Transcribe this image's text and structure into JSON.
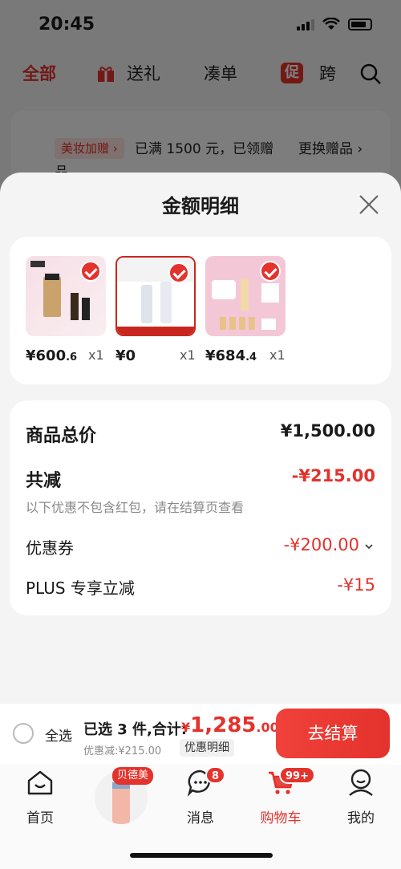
{
  "status_bar": {
    "time": "20:45"
  },
  "background_page": {
    "tabs": [
      {
        "label": "全部"
      },
      {
        "label": "送礼"
      },
      {
        "label": "凑单"
      },
      {
        "label": "跨"
      }
    ],
    "promo_badge": "促",
    "gift_row": {
      "tag": "美妆加赠 ›",
      "text": "已满 1500 元，已领赠",
      "change": "更换赠品 ›",
      "wrap": "品"
    }
  },
  "sheet": {
    "title": "金额明细",
    "products": [
      {
        "price_main": "¥600",
        "price_dec": ".6",
        "qty": "x1"
      },
      {
        "price_main": "¥0",
        "price_dec": "",
        "qty": "x1"
      },
      {
        "price_main": "¥684",
        "price_dec": ".4",
        "qty": "x1"
      }
    ],
    "summary": {
      "total_label": "商品总价",
      "total_value": "¥1,500.00",
      "reduce_label": "共减",
      "reduce_value": "-¥215.00",
      "note": "以下优惠不包含红包，请在结算页查看",
      "coupon_label": "优惠券",
      "coupon_value": "-¥200.00",
      "plus_label": "PLUS 专享立减",
      "plus_value": "-¥15"
    }
  },
  "checkout": {
    "select_all": "全选",
    "selected": "已选 3 件,合计:",
    "currency": "¥",
    "total_int": "1,285",
    "total_dec": ".00",
    "discount": "优惠减:¥215.00",
    "detail_button": "优惠明细",
    "pay_button": "去结算"
  },
  "tab_bar": {
    "items": [
      {
        "label": "首页"
      },
      {
        "label": "消息",
        "badge": "8"
      },
      {
        "label": "购物车",
        "badge": "99+"
      },
      {
        "label": "我的"
      }
    ],
    "promo_tag": "贝德美"
  },
  "colors": {
    "accent": "#e4322c"
  }
}
